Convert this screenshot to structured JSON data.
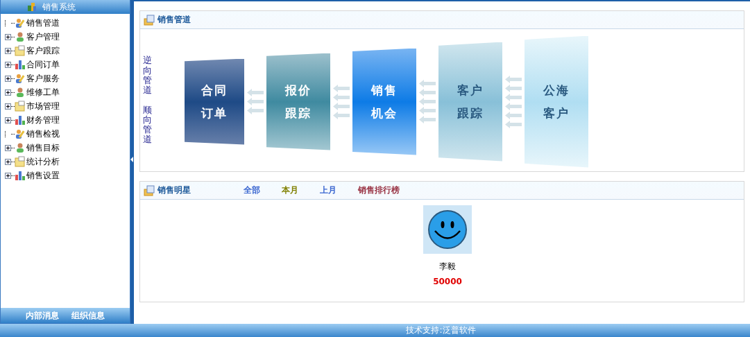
{
  "sidebar": {
    "title": "销售系统",
    "items": [
      {
        "label": "销售管道",
        "kind": "leaf"
      },
      {
        "label": "客户管理",
        "kind": "folder",
        "expanded": false
      },
      {
        "label": "客户跟踪",
        "kind": "folder",
        "expanded": false
      },
      {
        "label": "合同订单",
        "kind": "folder",
        "expanded": false
      },
      {
        "label": "客户服务",
        "kind": "folder",
        "expanded": false
      },
      {
        "label": "维修工单",
        "kind": "folder",
        "expanded": false
      },
      {
        "label": "市场管理",
        "kind": "folder",
        "expanded": false
      },
      {
        "label": "财务管理",
        "kind": "folder",
        "expanded": false
      },
      {
        "label": "销售检视",
        "kind": "leaf"
      },
      {
        "label": "销售目标",
        "kind": "folder",
        "expanded": false
      },
      {
        "label": "统计分析",
        "kind": "folder",
        "expanded": false
      },
      {
        "label": "销售设置",
        "kind": "folder",
        "expanded": false
      }
    ],
    "buttons": [
      "内部消息",
      "组织信息"
    ]
  },
  "pipeline": {
    "title": "销售管道",
    "reverse_label": "逆向管道",
    "forward_label": "顺向管道",
    "stages": [
      {
        "lines": [
          "合同",
          "订单"
        ]
      },
      {
        "lines": [
          "报价",
          "跟踪"
        ]
      },
      {
        "lines": [
          "销售",
          "机会"
        ]
      },
      {
        "lines": [
          "客户",
          "跟踪"
        ]
      },
      {
        "lines": [
          "公海",
          "客户"
        ]
      }
    ]
  },
  "stars": {
    "title": "销售明星",
    "tabs": [
      {
        "label": "全部",
        "color": "#3a66d0"
      },
      {
        "label": "本月",
        "color": "#808000"
      },
      {
        "label": "上月",
        "color": "#3a66d0"
      },
      {
        "label": "销售排行榜",
        "color": "#993344"
      }
    ],
    "people": [
      {
        "name": "李毅",
        "amount": "50000"
      }
    ]
  },
  "status_bar": "技术支持:泛普软件"
}
